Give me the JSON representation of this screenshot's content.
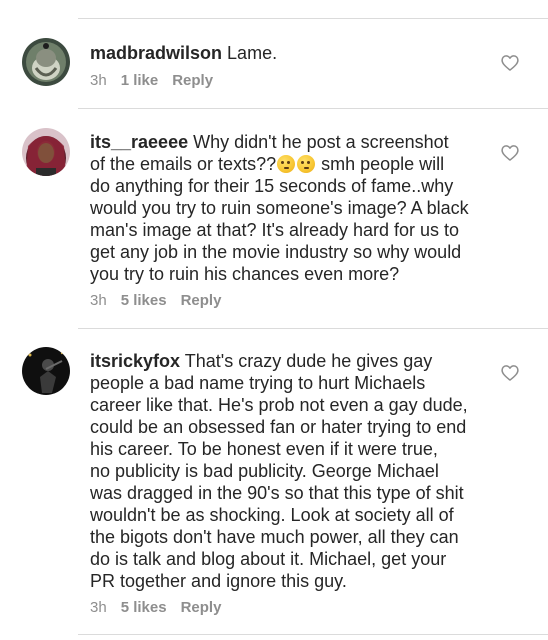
{
  "comments": [
    {
      "username": "madbradwilson",
      "text": "Lame.",
      "time": "3h",
      "likes": "1 like",
      "reply": "Reply",
      "avatar": "user-avatar-icon"
    },
    {
      "username": "its__raeeee",
      "text_before_emoji": "Why didn't he post a screenshot\nof the emails or texts??",
      "emoji": "thinking-face-icon",
      "text_after_emoji": " smh people will\ndo anything for their 15 seconds of fame..why\nwould you try to ruin someone's image? A black\nman's image at that? It's already hard for us to\nget any job in the movie industry so why would\nyou try to ruin his chances even more?",
      "time": "3h",
      "likes": "5 likes",
      "reply": "Reply",
      "avatar": "user-avatar-icon"
    },
    {
      "username": "itsrickyfox",
      "text": "That's crazy dude he gives gay\npeople a bad name trying to hurt Michaels\ncareer like that. He's prob not even a gay dude,\ncould be an obsessed fan or hater trying to end\nhis career. To be honest even if it were true,\nno publicity is bad publicity. George Michael\nwas dragged in the 90's so that this type of shit\nwouldn't be as shocking. Look at society all of\nthe bigots don't have much power, all they can\ndo is talk and blog about it. Michael, get your\nPR together and ignore this guy.",
      "time": "3h",
      "likes": "5 likes",
      "reply": "Reply",
      "avatar": "user-avatar-icon"
    }
  ],
  "colors": {
    "text": "#262626",
    "meta": "#8e8e8e",
    "divider": "#dbdbdb"
  },
  "icons": {
    "like": "heart-outline-icon"
  }
}
